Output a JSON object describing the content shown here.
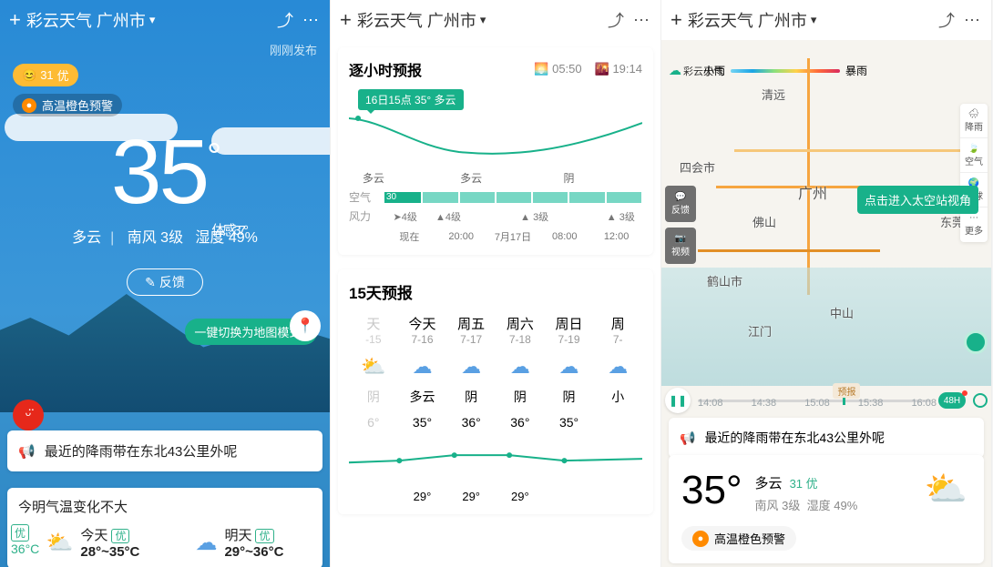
{
  "header": {
    "appName": "彩云天气",
    "city": "广州市"
  },
  "screen1": {
    "published": "刚刚发布",
    "aqiValue": "31",
    "aqiLevel": "优",
    "alert": "高温橙色预警",
    "temp": "35",
    "feels": "体感37°",
    "cond": "多云",
    "wind": "南风 3级",
    "humidity": "湿度 49%",
    "feedback": "反馈",
    "mapMode": "一键切换为地图模式~",
    "rainMsg": "最近的降雨带在东北43公里外呢",
    "briefTitle": "今明气温变化不大",
    "edgeTemp": "36°C",
    "today": {
      "label": "今天",
      "range": "28°~35°C",
      "level": "优"
    },
    "tomorrow": {
      "label": "明天",
      "range": "29°~36°C",
      "level": "优"
    }
  },
  "screen2": {
    "hourlyTitle": "逐小时预报",
    "sunrise": "05:50",
    "sunset": "19:14",
    "tip": "16日15点 35° 多云",
    "condLabels": {
      "c1": "多云",
      "c2": "多云",
      "c3": "阴"
    },
    "rows": {
      "air": "空气",
      "airFirst": "30",
      "wind": "风力"
    },
    "windCells": [
      "4级",
      "▲4级",
      "",
      "3级",
      "",
      "3级"
    ],
    "times": [
      "现在",
      "20:00",
      "7月17日",
      "08:00",
      "12:00"
    ],
    "d15title": "15天预报",
    "days": [
      {
        "dow": "天",
        "date": "-15",
        "cond": "阴",
        "hi": "6°",
        "dim": true
      },
      {
        "dow": "今天",
        "date": "7-16",
        "cond": "多云",
        "hi": "35°"
      },
      {
        "dow": "周五",
        "date": "7-17",
        "cond": "阴",
        "hi": "36°"
      },
      {
        "dow": "周六",
        "date": "7-18",
        "cond": "阴",
        "hi": "36°"
      },
      {
        "dow": "周日",
        "date": "7-19",
        "cond": "阴",
        "hi": "35°"
      },
      {
        "dow": "周",
        "date": "7-",
        "cond": "小",
        "hi": ""
      }
    ],
    "lows": [
      "",
      "29°",
      "29°",
      "29°",
      "",
      ""
    ]
  },
  "screen3": {
    "legend": {
      "lo": "小雨",
      "hi": "暴雨"
    },
    "brand": "彩云天气",
    "spaceBtn": "点击进入太空站视角",
    "rightTools": [
      "降雨",
      "空气",
      "地球",
      "更多"
    ],
    "leftTools": [
      "反馈",
      "视频"
    ],
    "cities": {
      "gz": "广州",
      "qy": "清远",
      "sh": "四会市",
      "fs": "佛山",
      "dg": "东莞",
      "hs": "鹤山市",
      "zs": "中山",
      "jm": "江门"
    },
    "timeline": {
      "t1": "14:08",
      "t2": "14:38",
      "t3": "15:08",
      "t4": "15:38",
      "t5": "16:08",
      "pred": "预报",
      "h48": "48H"
    },
    "rainMsg": "最近的降雨带在东北43公里外呢",
    "bot": {
      "temp": "35°",
      "cond": "多云",
      "aqi": "31 优",
      "wind": "南风 3级",
      "hum": "湿度 49%",
      "alert": "高温橙色预警"
    }
  }
}
